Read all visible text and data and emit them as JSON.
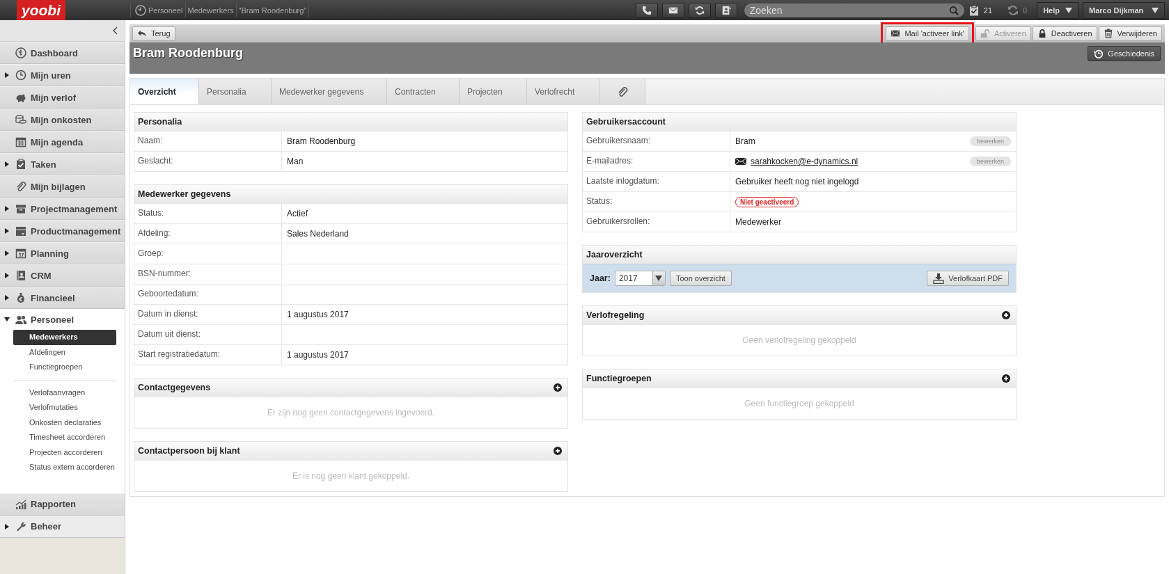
{
  "topbar": {
    "logo": "yoobi",
    "breadcrumbs": [
      "Personeel",
      "Medewerkers",
      "\"Bram Roodenburg\""
    ],
    "search": {
      "placeholder": "Zoeken"
    },
    "task_count": "21",
    "sync_count": "0",
    "help": "Help",
    "user": "Marco Dijkman"
  },
  "sidebar": {
    "items": [
      {
        "label": "Dashboard",
        "kind": "link",
        "expanded": false
      },
      {
        "label": "Mijn uren",
        "kind": "group",
        "expanded": false
      },
      {
        "label": "Mijn verlof",
        "kind": "link",
        "expanded": false
      },
      {
        "label": "Mijn onkosten",
        "kind": "link",
        "expanded": false
      },
      {
        "label": "Mijn agenda",
        "kind": "link",
        "expanded": false
      },
      {
        "label": "Taken",
        "kind": "group",
        "expanded": false
      },
      {
        "label": "Mijn bijlagen",
        "kind": "link",
        "expanded": false
      },
      {
        "label": "Projectmanagement",
        "kind": "group",
        "expanded": false
      },
      {
        "label": "Productmanagement",
        "kind": "group",
        "expanded": false
      },
      {
        "label": "Planning",
        "kind": "group",
        "expanded": false
      },
      {
        "label": "CRM",
        "kind": "group",
        "expanded": false
      },
      {
        "label": "Financieel",
        "kind": "group",
        "expanded": false
      },
      {
        "label": "Personeel",
        "kind": "group",
        "expanded": true,
        "children": [
          {
            "label": "Medewerkers",
            "selected": true,
            "group_break": false
          },
          {
            "label": "Afdelingen",
            "selected": false,
            "group_break": false
          },
          {
            "label": "Functiegroepen",
            "selected": false,
            "group_break": false
          },
          {
            "label": "Verlofaanvragen",
            "selected": false,
            "group_break": true
          },
          {
            "label": "Verlofmutaties",
            "selected": false,
            "group_break": false
          },
          {
            "label": "Onkosten declaraties",
            "selected": false,
            "group_break": false
          },
          {
            "label": "Timesheet accorderen",
            "selected": false,
            "group_break": false
          },
          {
            "label": "Projecten accorderen",
            "selected": false,
            "group_break": false
          },
          {
            "label": "Status extern accorderen",
            "selected": false,
            "group_break": false
          }
        ]
      },
      {
        "label": "Rapporten",
        "kind": "link",
        "expanded": false
      },
      {
        "label": "Beheer",
        "kind": "group",
        "expanded": false
      }
    ]
  },
  "toolbar": {
    "back": "Terug",
    "actions": [
      {
        "label": "Mail 'activeer link'",
        "disabled": false,
        "highlighted": true
      },
      {
        "label": "Activeren",
        "disabled": true,
        "highlighted": false
      },
      {
        "label": "Deactiveren",
        "disabled": false,
        "highlighted": false
      },
      {
        "label": "Verwijderen",
        "disabled": false,
        "highlighted": false
      }
    ]
  },
  "title": "Bram Roodenburg",
  "history_button": "Geschiedenis",
  "tabs": [
    {
      "label": "Overzicht",
      "kind": "text",
      "selected": true
    },
    {
      "label": "Personalia",
      "kind": "text",
      "selected": false
    },
    {
      "label": "Medewerker gegevens",
      "kind": "text",
      "selected": false
    },
    {
      "label": "Contracten",
      "kind": "text",
      "selected": false
    },
    {
      "label": "Projecten",
      "kind": "text",
      "selected": false
    },
    {
      "label": "Verlofrecht",
      "kind": "text",
      "selected": false
    },
    {
      "kind": "icon",
      "selected": false
    }
  ],
  "left_sections": [
    {
      "title": "Personalia",
      "kind": "table",
      "addable": false,
      "rows": [
        {
          "label": "Naam:",
          "value": "Bram Roodenburg",
          "kind": "text"
        },
        {
          "label": "Geslacht:",
          "value": "Man",
          "kind": "text"
        }
      ]
    },
    {
      "title": "Medewerker gegevens",
      "kind": "table",
      "addable": false,
      "rows": [
        {
          "label": "Status:",
          "value": "Actief",
          "kind": "text"
        },
        {
          "label": "Afdeling:",
          "value": "Sales Nederland",
          "kind": "text"
        },
        {
          "label": "Groep:",
          "kind": "text"
        },
        {
          "label": "BSN-nummer:",
          "kind": "text"
        },
        {
          "label": "Geboortedatum:",
          "kind": "text"
        },
        {
          "label": "Datum in dienst:",
          "value": "1 augustus 2017",
          "kind": "text"
        },
        {
          "label": "Datum uit dienst:",
          "kind": "text"
        },
        {
          "label": "Start registratiedatum:",
          "value": "1 augustus 2017",
          "kind": "text"
        }
      ]
    },
    {
      "title": "Contactgegevens",
      "kind": "empty",
      "addable": true,
      "message": "Er zijn nog geen contactgegevens ingevoerd."
    },
    {
      "title": "Contactpersoon bij klant",
      "kind": "empty",
      "addable": true,
      "message": "Er is nog geen klant gekoppeld."
    }
  ],
  "right_sections": [
    {
      "title": "Gebruikersaccount",
      "kind": "table",
      "addable": false,
      "rows": [
        {
          "label": "Gebruikersnaam:",
          "value": "Bram",
          "kind": "text",
          "edit": "bewerken"
        },
        {
          "label": "E-mailadres:",
          "value": "sarahkocken@e-dynamics.nl",
          "kind": "email",
          "edit": "bewerken"
        },
        {
          "label": "Laatste inlogdatum:",
          "value": "Gebruiker heeft nog niet ingelogd",
          "kind": "text"
        },
        {
          "label": "Status:",
          "value": "Niet geactiveerd",
          "kind": "badge"
        },
        {
          "label": "Gebruikersrollen:",
          "value": "Medewerker",
          "kind": "text"
        }
      ]
    },
    {
      "title": "Jaaroverzicht",
      "kind": "year",
      "addable": false,
      "year_label": "Jaar:",
      "year": "2017",
      "show_button": "Toon overzicht",
      "pdf_button": "Verlofkaart PDF"
    },
    {
      "title": "Verlofregeling",
      "kind": "empty",
      "addable": true,
      "message": "Geen verlofregeling gekoppeld"
    },
    {
      "title": "Functiegroepen",
      "kind": "empty",
      "addable": true,
      "message": "Geen functiegroep gekoppeld"
    }
  ]
}
